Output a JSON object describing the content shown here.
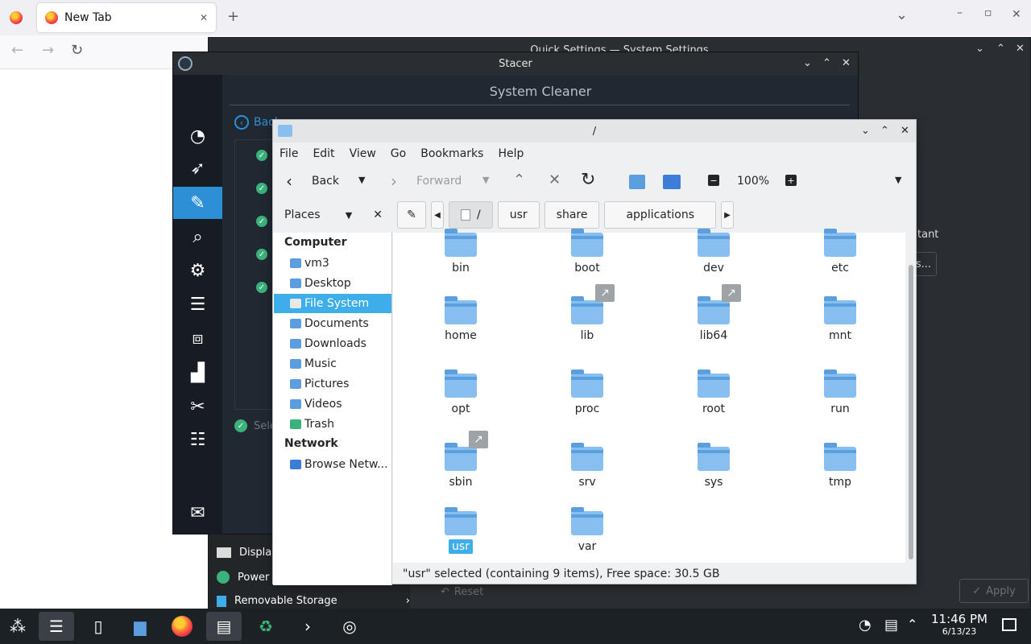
{
  "browser": {
    "tab_title": "New Tab",
    "back_glyph": "←",
    "forward_glyph": "→",
    "reload_glyph": "↻",
    "new_tab_glyph": "+",
    "close_glyph": "✕",
    "list_glyph": "⌄",
    "minimize_glyph": "–",
    "maximize_glyph": "▫",
    "window_close_glyph": "✕"
  },
  "settings_window": {
    "title": "Quick Settings — System Settings",
    "sidebar_visible": [
      "Display",
      "Power",
      "Removable Storage"
    ],
    "right_visible": [
      "tant",
      "s..."
    ],
    "reset_label": "Reset",
    "apply_label": "Apply"
  },
  "stacer": {
    "title": "Stacer",
    "section_title": "System Cleaner",
    "back_label": "Back",
    "select_label": "Sele",
    "sidebar_icons": [
      "dashboard-icon",
      "startup-rocket-icon",
      "cleaner-broom-icon",
      "search-icon",
      "services-gears-icon",
      "processes-icon",
      "uninstaller-icon",
      "resources-chart-icon",
      "helpers-tools-icon",
      "settings-sliders-icon",
      "feedback-icon"
    ]
  },
  "file_manager": {
    "title": "/",
    "menu": [
      "File",
      "Edit",
      "View",
      "Go",
      "Bookmarks",
      "Help"
    ],
    "back_label": "Back",
    "forward_label": "Forward",
    "zoom": "100%",
    "places_label": "Places",
    "breadcrumbs": [
      "/",
      "usr",
      "share",
      "applications"
    ],
    "places": {
      "computer_heading": "Computer",
      "network_heading": "Network",
      "computer_items": [
        "vm3",
        "Desktop",
        "File System",
        "Documents",
        "Downloads",
        "Music",
        "Pictures",
        "Videos",
        "Trash"
      ],
      "network_items": [
        "Browse Netw..."
      ],
      "selected": "File System"
    },
    "folders": [
      {
        "name": "bin",
        "link": false
      },
      {
        "name": "boot",
        "link": false
      },
      {
        "name": "dev",
        "link": false
      },
      {
        "name": "etc",
        "link": false
      },
      {
        "name": "home",
        "link": false
      },
      {
        "name": "lib",
        "link": true
      },
      {
        "name": "lib64",
        "link": true
      },
      {
        "name": "mnt",
        "link": false
      },
      {
        "name": "opt",
        "link": false
      },
      {
        "name": "proc",
        "link": false
      },
      {
        "name": "root",
        "link": false
      },
      {
        "name": "run",
        "link": false
      },
      {
        "name": "sbin",
        "link": true
      },
      {
        "name": "srv",
        "link": false
      },
      {
        "name": "sys",
        "link": false
      },
      {
        "name": "tmp",
        "link": false
      },
      {
        "name": "usr",
        "link": false,
        "selected": true
      },
      {
        "name": "var",
        "link": false
      }
    ],
    "status": "\"usr\" selected (containing 9 items), Free space: 30.5 GB"
  },
  "taskbar": {
    "time": "11:46 PM",
    "date": "6/13/23",
    "tasks": [
      "app-launcher-icon",
      "system-settings-icon",
      "text-file-icon",
      "file-manager-icon",
      "firefox-icon",
      "pcmanfm-icon",
      "recycle-icon",
      "terminal-icon",
      "stacer-icon"
    ]
  },
  "colors": {
    "accent": "#3daee9",
    "stacer_accent": "#2d8fd5",
    "folder": "#87bff0",
    "taskbar": "#1c2126"
  }
}
